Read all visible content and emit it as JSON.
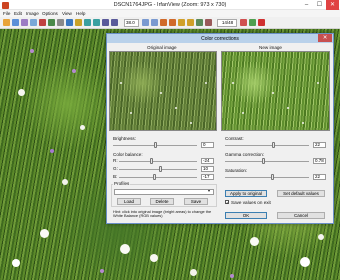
{
  "window": {
    "title": "DSCN1764JPG - IrfanView (Zoom: 973 x 730)",
    "min": "–",
    "max": "☐",
    "close": "✕"
  },
  "menu": [
    "File",
    "Edit",
    "Image",
    "Options",
    "View",
    "Help"
  ],
  "toolbar": {
    "zoom": "38.0",
    "page": "14/48"
  },
  "dialog": {
    "title": "Color corrections",
    "close": "✕",
    "original_label": "Original image",
    "new_label": "New image",
    "brightness": {
      "label": "Brightness:",
      "value": "0",
      "level": 0.5
    },
    "contrast": {
      "label": "Contrast:",
      "value": "22",
      "level": 0.58
    },
    "color_balance": {
      "label": "Color balance:",
      "rows": [
        {
          "ch": "R:",
          "value": "-24",
          "level": 0.42
        },
        {
          "ch": "G:",
          "value": "10",
          "level": 0.53
        },
        {
          "ch": "B:",
          "value": "-17",
          "level": 0.45
        }
      ]
    },
    "gamma": {
      "label": "Gamma correction:",
      "value": "0.78",
      "level": 0.46
    },
    "saturation": {
      "label": "Saturation:",
      "value": "22",
      "level": 0.57
    },
    "profiles": {
      "label": "Profiles",
      "selected": ""
    },
    "buttons": {
      "load": "Load",
      "delete": "Delete",
      "save": "Save",
      "apply": "Apply to original",
      "set_default": "Set default values",
      "ok": "OK",
      "cancel": "Cancel"
    },
    "save_checkbox": "Save values on exit",
    "hint": "Hint: click into original image (bright areas) to change the White Balance (RGB values)"
  }
}
